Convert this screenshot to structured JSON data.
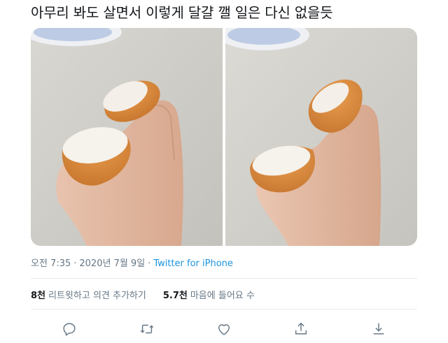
{
  "tweet": {
    "text": "아무리 봐도 살면서 이렇게 달걀 깰 일은 다신 없을듯"
  },
  "meta": {
    "time": "오전 7:35",
    "separator": "·",
    "date": "2020년 7월 9일",
    "source": "Twitter for iPhone"
  },
  "stats": {
    "retweets_count": "8천",
    "retweets_label": "리트윗하고 의견 추가하기",
    "likes_count": "5.7천",
    "likes_label": "마음에 들어요 수"
  },
  "actions": [
    {
      "name": "reply",
      "icon": "reply-icon"
    },
    {
      "name": "retweet",
      "icon": "retweet-icon"
    },
    {
      "name": "like",
      "icon": "heart-icon"
    },
    {
      "name": "share",
      "icon": "share-icon"
    },
    {
      "name": "download",
      "icon": "download-icon"
    }
  ],
  "colors": {
    "meta_gray": "#657786",
    "link_blue": "#1b95e0",
    "icon_gray": "#657786",
    "eggshell_orange": "#d98a3a"
  }
}
